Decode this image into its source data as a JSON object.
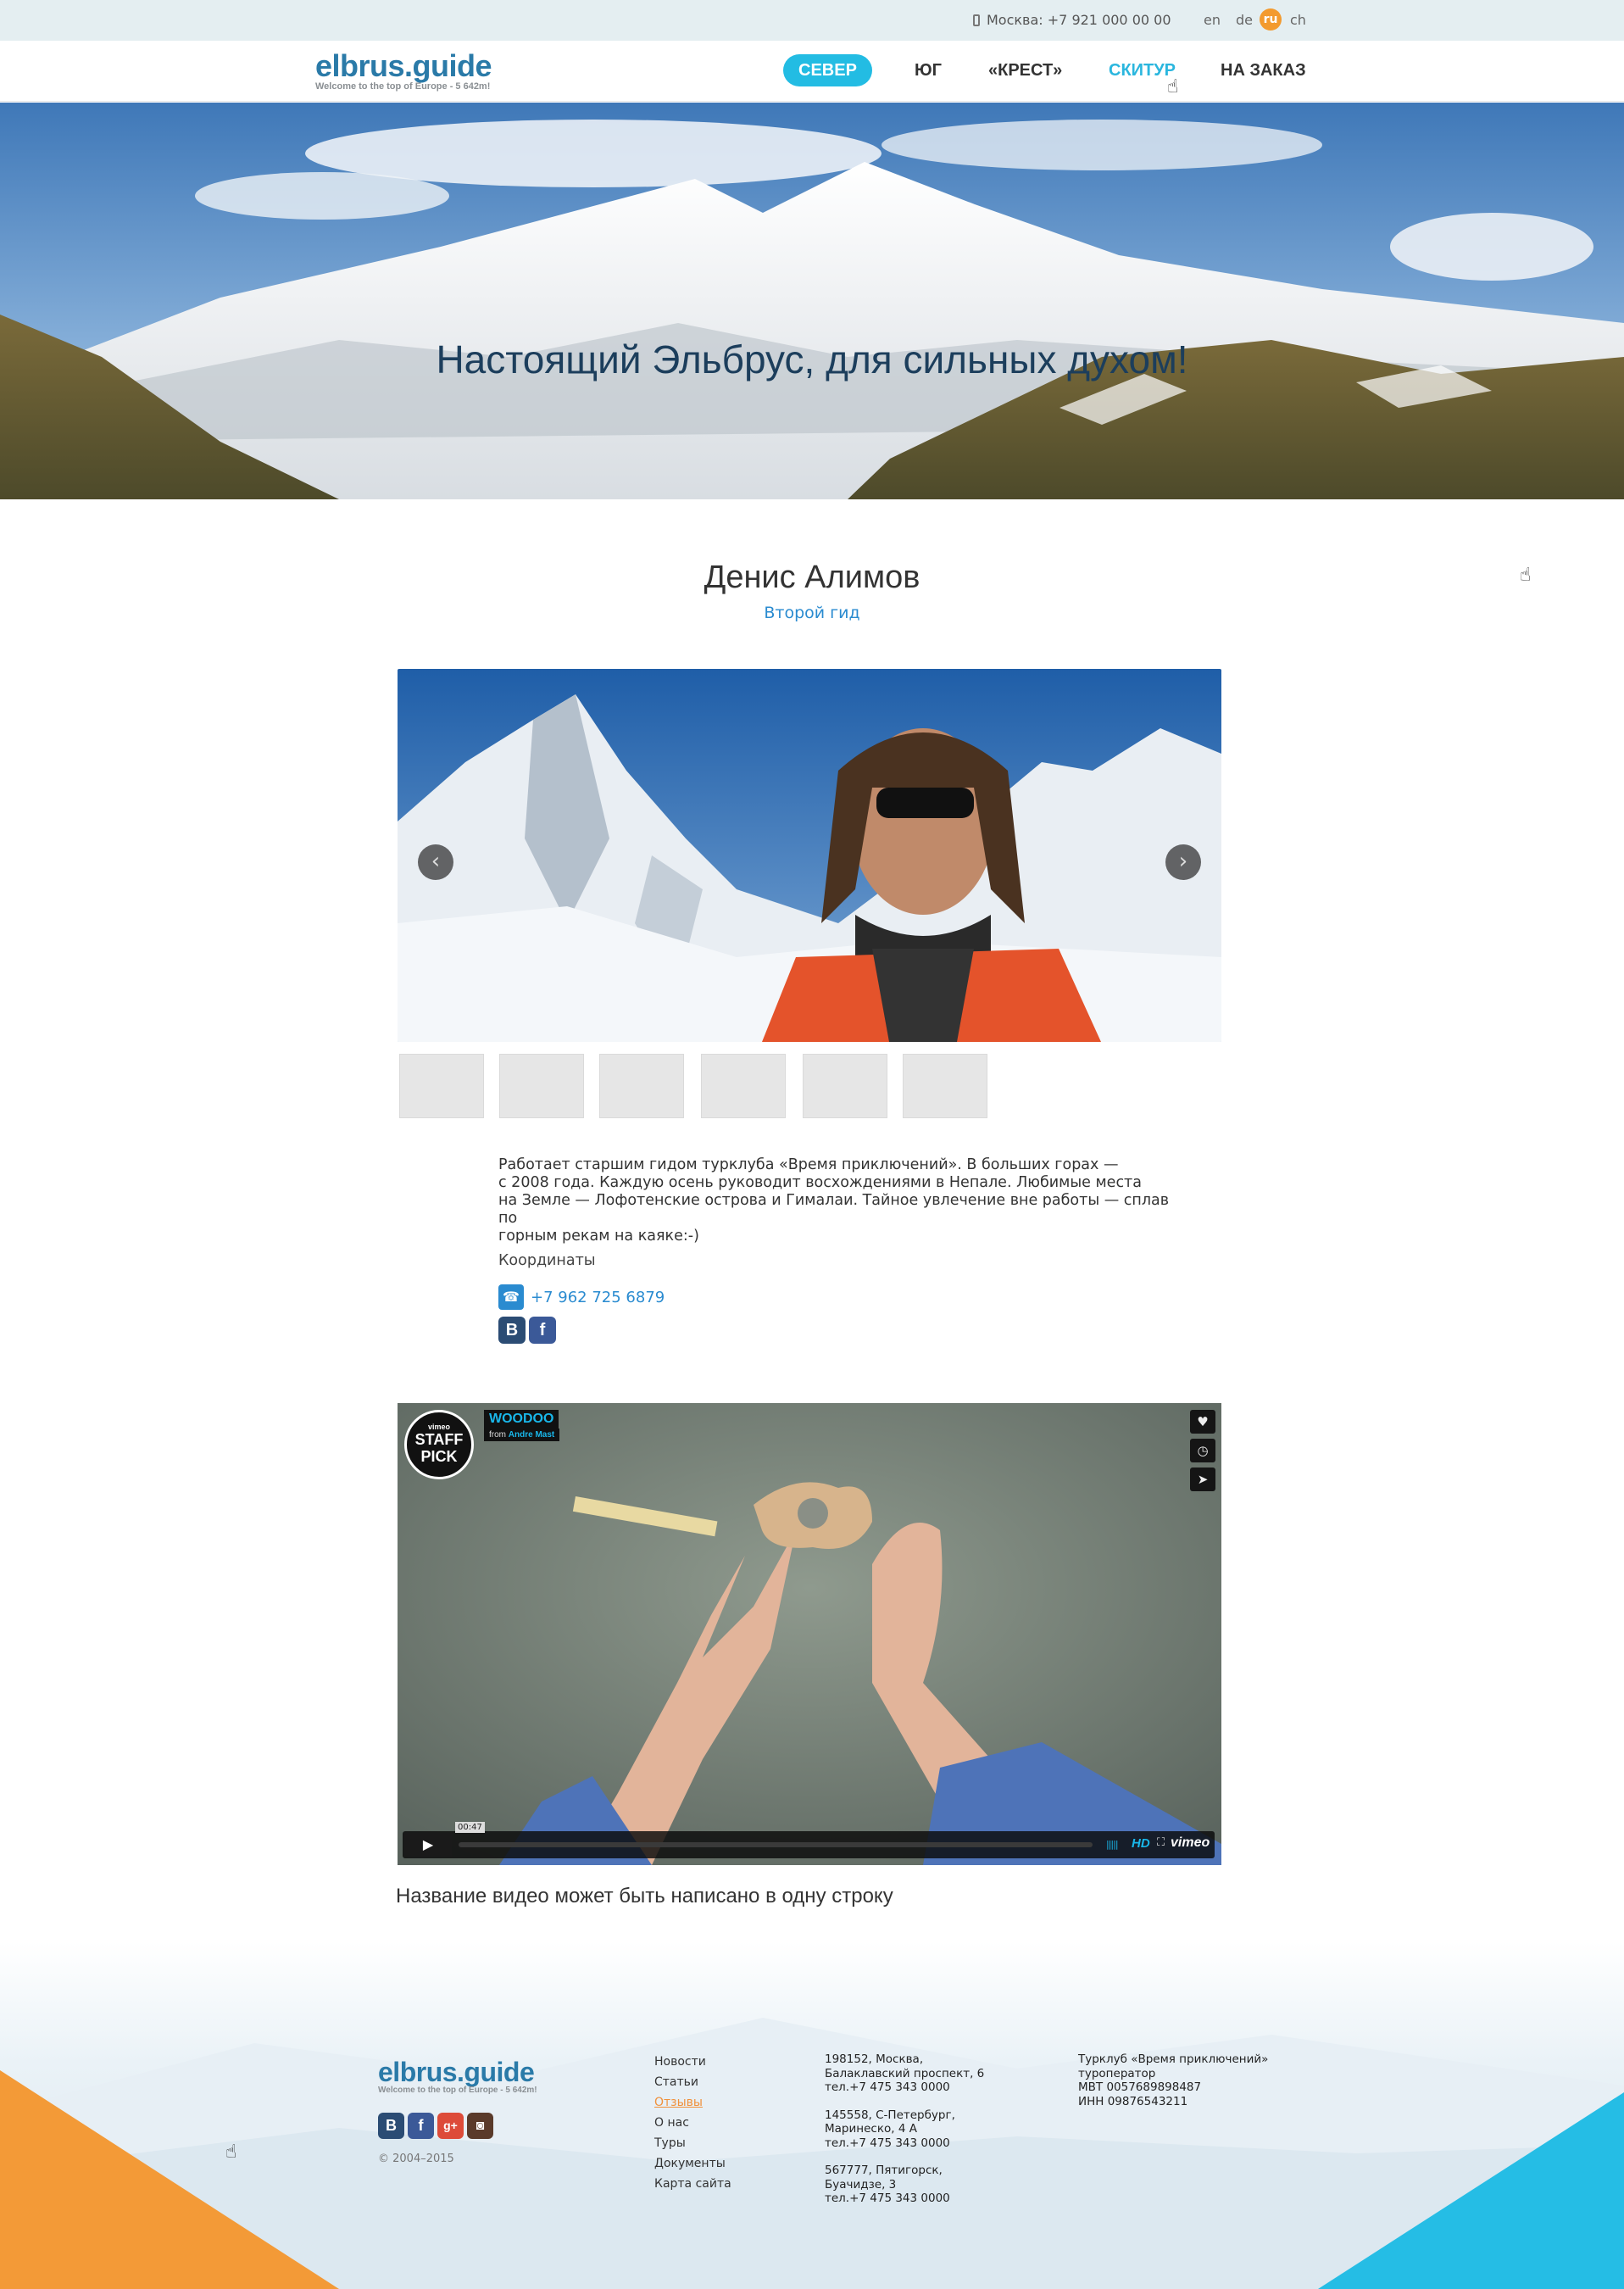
{
  "topbar": {
    "phone": "Москва: +7 921 000 00 00",
    "languages": [
      "en",
      "de",
      "ru",
      "ch"
    ],
    "active_language": "ru"
  },
  "header": {
    "logo_name": "elbrus.guide",
    "logo_tagline": "Welcome to the top of Europe - 5 642m!",
    "nav": [
      "СЕВЕР",
      "ЮГ",
      "«КРЕСТ»",
      "СКИТУР",
      "НА ЗАКАЗ"
    ],
    "active_nav": "СЕВЕР",
    "hovered_nav": "СКИТУР"
  },
  "hero": {
    "title": "Настоящий Эльбрус, для сильных духом!"
  },
  "guide": {
    "name": "Денис Алимов",
    "role": "Второй гид",
    "slider_thumbnail_count": 6,
    "bio_lines": [
      "Работает старшим гидом турклуба «Время приключений». В больших горах —",
      "с 2008 года. Каждую осень руководит восхождениями в Непале. Любимые места",
      "на Земле — Лофотенские острова и Гималаи. Тайное увлечение вне работы — сплав по",
      "горным рекам на каяке:-)"
    ],
    "coordinates_title": "Координаты",
    "phone": "+7 962 725 6879",
    "socials": [
      "vk-icon",
      "facebook-icon"
    ]
  },
  "video": {
    "badge_top": "vimeo",
    "badge_text": "STAFF PICK",
    "title": "WOODOO",
    "from_label": "from",
    "author": "Andre Mast",
    "time": "00:47",
    "hd_label": "HD",
    "vimeo_label": "vimeo",
    "caption": "Название видео может быть написано в одну строку"
  },
  "footer": {
    "logo_name": "elbrus.guide",
    "logo_tagline": "Welcome to the top of Europe - 5 642m!",
    "copyright": "© 2004–2015",
    "menu": [
      "Новости",
      "Статьи",
      "Отзывы",
      "О нас",
      "Туры",
      "Документы",
      "Карта сайта"
    ],
    "active_menu": "Отзывы",
    "addresses": [
      [
        "198152, Москва,",
        "Балаклавский проспект, 6",
        "тел.+7 475 343 0000"
      ],
      [
        "145558, С-Петербург,",
        "Маринеско, 4 А",
        "тел.+7 475 343 0000"
      ],
      [
        "567777, Пятигорск,",
        "Буачидзе, 3",
        "тел.+7 475 343 0000"
      ]
    ],
    "company": [
      "Турклуб «Время приключений»",
      "туроператор",
      "МВТ 0057689898487",
      "ИНН 09876543211"
    ],
    "socials": [
      "vk-icon",
      "facebook-icon",
      "google-plus-icon",
      "instagram-icon"
    ]
  },
  "colors": {
    "accent_blue": "#23bce3",
    "link_blue": "#2a8bd0",
    "logo_blue": "#2a7aa8",
    "orange": "#f39a2e"
  }
}
